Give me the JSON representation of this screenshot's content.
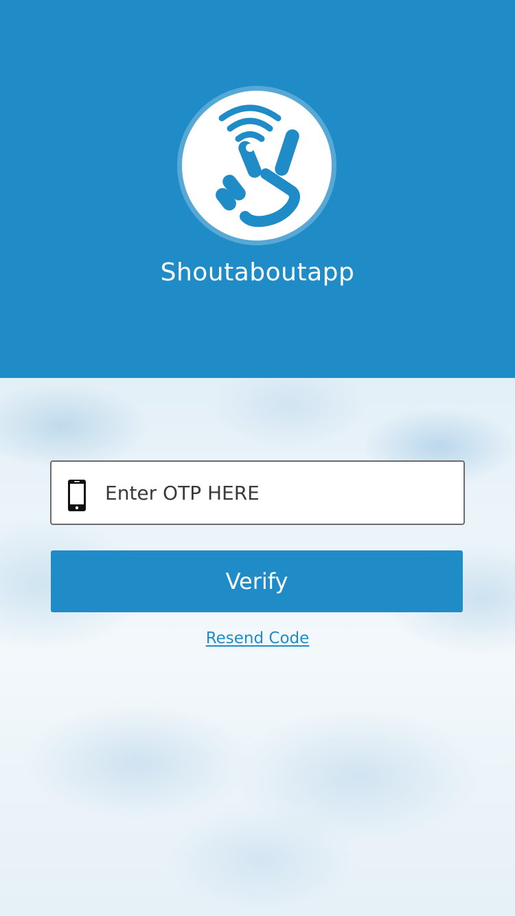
{
  "header": {
    "app_name": "Shoutaboutapp",
    "logo_icon": "peace-hand-wifi-logo",
    "background_color": "#1f8cc8"
  },
  "form": {
    "otp_placeholder": "Enter OTP HERE",
    "otp_value": "",
    "phone_icon": "mobile-phone-icon",
    "verify_label": "Verify",
    "resend_label": "Resend Code"
  },
  "colors": {
    "accent": "#1f8cc8",
    "logo_ring": "#58a8d6",
    "button_text": "#ffffff"
  }
}
